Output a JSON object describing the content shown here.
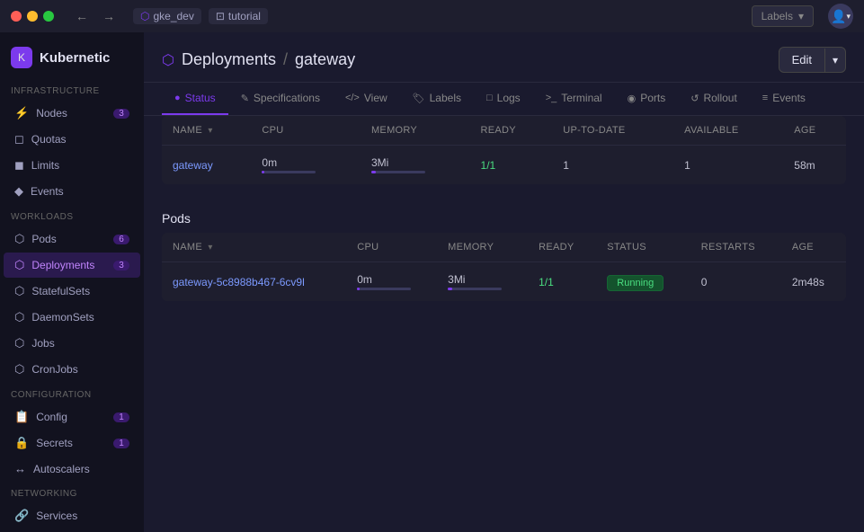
{
  "titlebar": {
    "nav_back": "←",
    "nav_forward": "→",
    "gke_label": "gke_dev",
    "tutorial_label": "tutorial",
    "labels_placeholder": "Labels",
    "labels_dropdown_arrow": "▾"
  },
  "sidebar": {
    "brand_name": "Kubernetic",
    "sections": [
      {
        "label": "Infrastructure",
        "items": [
          {
            "id": "nodes",
            "label": "Nodes",
            "badge": "3",
            "icon": "⚡"
          },
          {
            "id": "quotas",
            "label": "Quotas",
            "badge": null,
            "icon": "◻"
          },
          {
            "id": "limits",
            "label": "Limits",
            "badge": null,
            "icon": "◼"
          },
          {
            "id": "events",
            "label": "Events",
            "badge": null,
            "icon": "◆"
          }
        ]
      },
      {
        "label": "Workloads",
        "items": [
          {
            "id": "pods",
            "label": "Pods",
            "badge": "6",
            "icon": "⬡"
          },
          {
            "id": "deployments",
            "label": "Deployments",
            "badge": "3",
            "icon": "⬡",
            "active": true
          },
          {
            "id": "statefulsets",
            "label": "StatefulSets",
            "badge": null,
            "icon": "⬡"
          },
          {
            "id": "daemonsets",
            "label": "DaemonSets",
            "badge": null,
            "icon": "⬡"
          },
          {
            "id": "jobs",
            "label": "Jobs",
            "badge": null,
            "icon": "⬡"
          },
          {
            "id": "cronjobs",
            "label": "CronJobs",
            "badge": null,
            "icon": "⬡"
          }
        ]
      },
      {
        "label": "Configuration",
        "items": [
          {
            "id": "config",
            "label": "Config",
            "badge": "1",
            "icon": "📋"
          },
          {
            "id": "secrets",
            "label": "Secrets",
            "badge": "1",
            "icon": "🔒"
          },
          {
            "id": "autoscalers",
            "label": "Autoscalers",
            "badge": null,
            "icon": "↔"
          }
        ]
      },
      {
        "label": "Networking",
        "items": [
          {
            "id": "services",
            "label": "Services",
            "badge": null,
            "icon": "🔗"
          }
        ]
      }
    ]
  },
  "breadcrumb": {
    "parent": "Deployments",
    "separator": "/",
    "current": "gateway"
  },
  "edit_button": "Edit",
  "tabs": [
    {
      "id": "status",
      "label": "Status",
      "icon": "●",
      "active": true
    },
    {
      "id": "specifications",
      "label": "Specifications",
      "icon": "✎"
    },
    {
      "id": "view",
      "label": "View",
      "icon": "<>"
    },
    {
      "id": "labels",
      "label": "Labels",
      "icon": "🏷"
    },
    {
      "id": "logs",
      "label": "Logs",
      "icon": "□"
    },
    {
      "id": "terminal",
      "label": "Terminal",
      "icon": ">"
    },
    {
      "id": "ports",
      "label": "Ports",
      "icon": "◉"
    },
    {
      "id": "rollout",
      "label": "Rollout",
      "icon": "↺"
    },
    {
      "id": "events",
      "label": "Events",
      "icon": "≡"
    }
  ],
  "deployments_table": {
    "columns": [
      {
        "id": "name",
        "label": "NAME",
        "sortable": true
      },
      {
        "id": "cpu",
        "label": "CPU"
      },
      {
        "id": "memory",
        "label": "MEMORY"
      },
      {
        "id": "ready",
        "label": "READY"
      },
      {
        "id": "up_to_date",
        "label": "UP-TO-DATE"
      },
      {
        "id": "available",
        "label": "AVAILABLE"
      },
      {
        "id": "age",
        "label": "AGE"
      }
    ],
    "rows": [
      {
        "name": "gateway",
        "cpu": "0m",
        "memory": "3Mi",
        "ready": "1/1",
        "up_to_date": "1",
        "available": "1",
        "age": "58m"
      }
    ]
  },
  "pods_section": {
    "title": "Pods",
    "columns": [
      {
        "id": "name",
        "label": "NAME",
        "sortable": true
      },
      {
        "id": "cpu",
        "label": "CPU"
      },
      {
        "id": "memory",
        "label": "MEMORY"
      },
      {
        "id": "ready",
        "label": "READY"
      },
      {
        "id": "status",
        "label": "STATUS"
      },
      {
        "id": "restarts",
        "label": "RESTARTS"
      },
      {
        "id": "age",
        "label": "AGE"
      }
    ],
    "rows": [
      {
        "name": "gateway-5c8988b467-6cv9l",
        "cpu": "0m",
        "memory": "3Mi",
        "ready": "1/1",
        "status": "Running",
        "restarts": "0",
        "age": "2m48s"
      }
    ]
  }
}
